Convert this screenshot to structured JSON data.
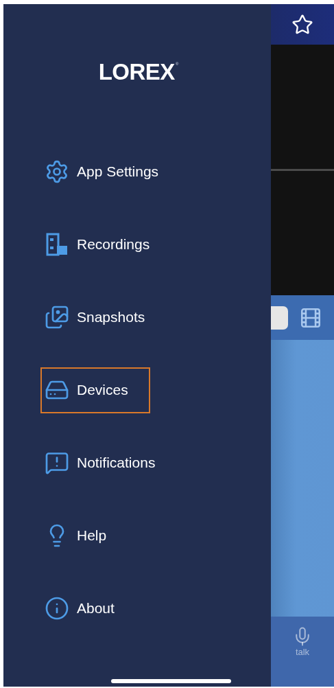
{
  "drawer": {
    "logo": {
      "text": "LOREX",
      "mark": "®"
    },
    "items": [
      {
        "kind": "settings",
        "label": "App Settings",
        "highlighted": false
      },
      {
        "kind": "recordings",
        "label": "Recordings",
        "highlighted": false
      },
      {
        "kind": "snapshots",
        "label": "Snapshots",
        "highlighted": false
      },
      {
        "kind": "devices",
        "label": "Devices",
        "highlighted": true
      },
      {
        "kind": "notifications",
        "label": "Notifications",
        "highlighted": false
      },
      {
        "kind": "help",
        "label": "Help",
        "highlighted": false
      },
      {
        "kind": "about",
        "label": "About",
        "highlighted": false
      }
    ]
  },
  "background_screen": {
    "bottom_bar": {
      "talk_label": "talk"
    }
  }
}
